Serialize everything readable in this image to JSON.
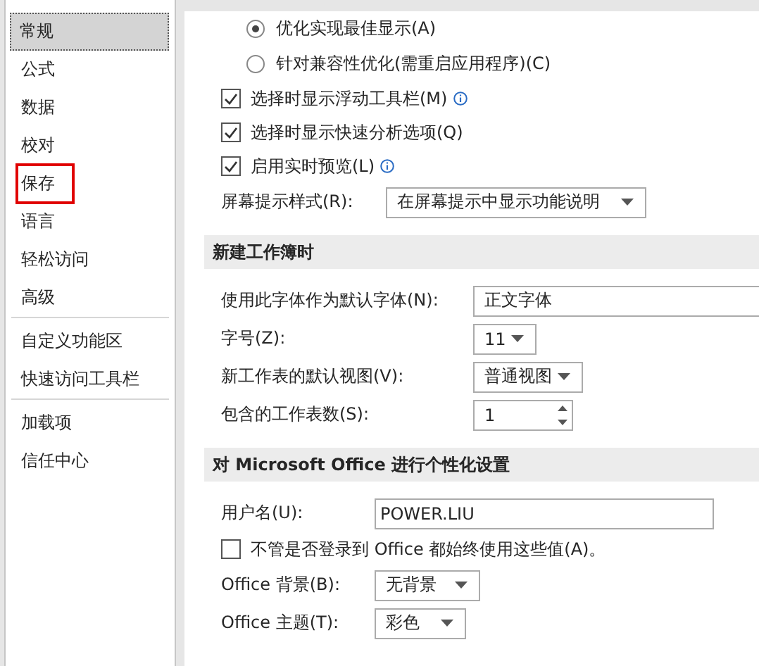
{
  "sidebar": {
    "groups": [
      {
        "items": [
          {
            "label": "常规",
            "selected": true,
            "highlighted": false
          },
          {
            "label": "公式",
            "selected": false,
            "highlighted": false
          },
          {
            "label": "数据",
            "selected": false,
            "highlighted": false
          },
          {
            "label": "校对",
            "selected": false,
            "highlighted": false
          },
          {
            "label": "保存",
            "selected": false,
            "highlighted": true
          },
          {
            "label": "语言",
            "selected": false,
            "highlighted": false
          },
          {
            "label": "轻松访问",
            "selected": false,
            "highlighted": false
          },
          {
            "label": "高级",
            "selected": false,
            "highlighted": false
          }
        ]
      },
      {
        "items": [
          {
            "label": "自定义功能区",
            "selected": false,
            "highlighted": false
          },
          {
            "label": "快速访问工具栏",
            "selected": false,
            "highlighted": false
          }
        ]
      },
      {
        "items": [
          {
            "label": "加载项",
            "selected": false,
            "highlighted": false
          },
          {
            "label": "信任中心",
            "selected": false,
            "highlighted": false
          }
        ]
      }
    ]
  },
  "sections": [
    {
      "items": [
        {
          "kind": "radio",
          "label": "优化实现最佳显示(A)",
          "selected": true
        },
        {
          "kind": "radio",
          "label": "针对兼容性优化(需重启应用程序)(C)",
          "selected": false
        },
        {
          "kind": "checkbox",
          "label": "选择时显示浮动工具栏(M)",
          "checked": true,
          "info": true
        },
        {
          "kind": "checkbox",
          "label": "选择时显示快速分析选项(Q)",
          "checked": true,
          "info": false
        },
        {
          "kind": "checkbox",
          "label": "启用实时预览(L)",
          "checked": true,
          "info": true
        },
        {
          "kind": "select",
          "label": "屏幕提示样式(R):",
          "value": "在屏幕提示中显示功能说明"
        }
      ]
    },
    {
      "title": "新建工作簿时",
      "items": [
        {
          "kind": "select",
          "label": "使用此字体作为默认字体(N):",
          "value": "正文字体"
        },
        {
          "kind": "select",
          "label": "字号(Z):",
          "value": "11"
        },
        {
          "kind": "select",
          "label": "新工作表的默认视图(V):",
          "value": "普通视图"
        },
        {
          "kind": "spin",
          "label": "包含的工作表数(S):",
          "value": "1"
        }
      ]
    },
    {
      "title": "对 Microsoft Office 进行个性化设置",
      "items": [
        {
          "kind": "text",
          "label": "用户名(U):",
          "value": "POWER.LIU"
        },
        {
          "kind": "checkbox",
          "label": "不管是否登录到 Office 都始终使用这些值(A)。",
          "checked": false,
          "info": false
        },
        {
          "kind": "select",
          "label": "Office 背景(B):",
          "value": "无背景"
        },
        {
          "kind": "select",
          "label": "Office 主题(T):",
          "value": "彩色"
        }
      ]
    }
  ]
}
